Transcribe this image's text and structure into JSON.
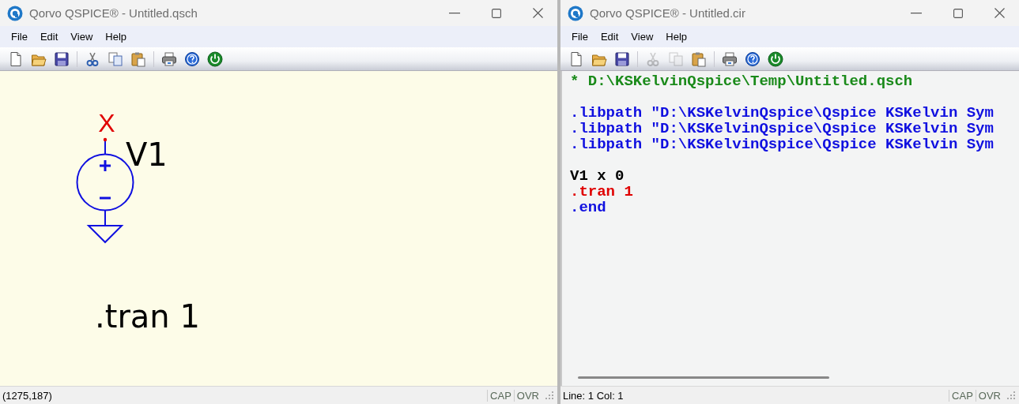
{
  "schematic_window": {
    "title": "Qorvo QSPICE® - Untitled.qsch",
    "menu": [
      "File",
      "Edit",
      "View",
      "Help"
    ],
    "toolbar": [
      {
        "kind": "new",
        "disabled": false
      },
      {
        "kind": "open",
        "disabled": false
      },
      {
        "kind": "save",
        "disabled": false
      },
      {
        "kind": "sep"
      },
      {
        "kind": "cut",
        "disabled": false
      },
      {
        "kind": "copy",
        "disabled": false
      },
      {
        "kind": "paste",
        "disabled": false
      },
      {
        "kind": "sep"
      },
      {
        "kind": "print",
        "disabled": false
      },
      {
        "kind": "help",
        "disabled": false
      },
      {
        "kind": "power",
        "disabled": false
      }
    ],
    "schematic": {
      "net_label": "X",
      "instance_name": "V1",
      "directive": ".tran 1"
    },
    "status_bar": {
      "position": "(1275,187)",
      "cap": "CAP",
      "ovr": "OVR"
    }
  },
  "netlist_window": {
    "title": "Qorvo QSPICE® - Untitled.cir",
    "menu": [
      "File",
      "Edit",
      "View",
      "Help"
    ],
    "toolbar": [
      {
        "kind": "new",
        "disabled": false
      },
      {
        "kind": "open",
        "disabled": false
      },
      {
        "kind": "save",
        "disabled": false
      },
      {
        "kind": "sep"
      },
      {
        "kind": "cut",
        "disabled": true
      },
      {
        "kind": "copy",
        "disabled": true
      },
      {
        "kind": "paste",
        "disabled": false
      },
      {
        "kind": "sep"
      },
      {
        "kind": "print",
        "disabled": false
      },
      {
        "kind": "help",
        "disabled": false
      },
      {
        "kind": "power",
        "disabled": false
      }
    ],
    "blocks": [
      [
        {
          "kind": "comment",
          "text": "* D:\\KSKelvinQspice\\Temp\\Untitled.qsch"
        }
      ],
      [
        {
          "kind": "directive",
          "text": ".libpath \"D:\\KSKelvinQspice\\Qspice KSKelvin Sym"
        },
        {
          "kind": "directive",
          "text": ".libpath \"D:\\KSKelvinQspice\\Qspice KSKelvin Sym"
        },
        {
          "kind": "directive",
          "text": ".libpath \"D:\\KSKelvinQspice\\Qspice KSKelvin Sym"
        }
      ],
      [
        {
          "kind": "element",
          "text": "V1 x 0"
        },
        {
          "kind": "analysis",
          "text": ".tran 1"
        },
        {
          "kind": "directive",
          "text": ".end"
        }
      ]
    ],
    "status_bar": {
      "position": "Line: 1 Col: 1",
      "cap": "CAP",
      "ovr": "OVR"
    }
  }
}
